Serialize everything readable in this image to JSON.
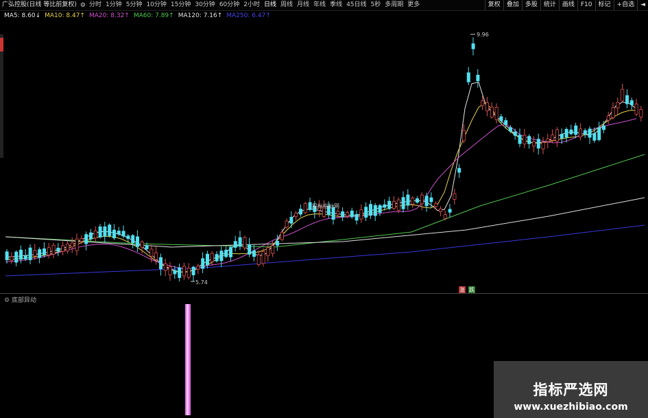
{
  "toolbar": {
    "periods": [
      "分时",
      "1分钟",
      "5分钟",
      "10分钟",
      "15分钟",
      "30分钟",
      "60分钟",
      "2小时",
      "日线",
      "周线",
      "月线",
      "年线",
      "季线",
      "45日线",
      "5秒",
      "多周期",
      "更多"
    ],
    "active_period": "日线",
    "right_buttons": [
      "复权",
      "叠加",
      "多股",
      "统计",
      "画线",
      "F10",
      "标记",
      "+自选",
      "◄"
    ]
  },
  "legend": {
    "stock_title": "广弘控股(日线 等比前复权)",
    "items": [
      {
        "label": "MA5: 8.60↓",
        "color": "#e8e8e8"
      },
      {
        "label": "MA10: 8.47↑",
        "color": "#e8d24a"
      },
      {
        "label": "MA20: 8.32↑",
        "color": "#d050d0"
      },
      {
        "label": "MA60: 7.89↑",
        "color": "#50c850"
      },
      {
        "label": "MA120: 7.16↑",
        "color": "#e0e0e0"
      },
      {
        "label": "MA250: 6.47↑",
        "color": "#4444ee"
      }
    ]
  },
  "annotations": {
    "high": "9.96",
    "low": "5.74",
    "mid_label": "股标指标网",
    "limit_up": "涨",
    "limit_down": "跌"
  },
  "sub_panel": {
    "title": "底部异动"
  },
  "watermark": {
    "title": "指标严选网",
    "url": "www.xuezhibiao.com"
  },
  "colors": {
    "up": "#e05050",
    "down": "#50e0f0",
    "ma5": "#e8e8e8",
    "ma10": "#e8d24a",
    "ma20": "#d050d0",
    "ma60": "#50c850",
    "ma120": "#e0e0e0",
    "ma250": "#3838e0",
    "signal": "#e070e8"
  }
}
